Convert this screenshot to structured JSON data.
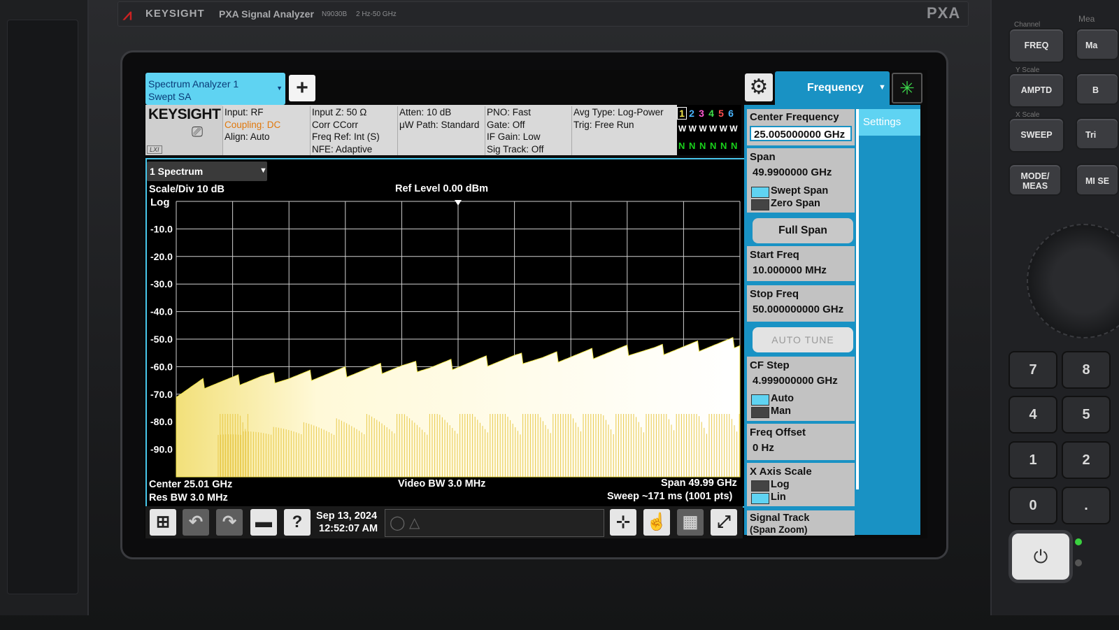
{
  "instrument": {
    "brand": "KEYSIGHT",
    "model": "PXA Signal Analyzer",
    "model_number": "N9030B",
    "freq_range": "2 Hz-50 GHz",
    "series_logo": "PXA"
  },
  "header": {
    "mode_tab_line1": "Spectrum Analyzer 1",
    "mode_tab_line2": "Swept SA",
    "add_label": "+",
    "menu_title": "Frequency"
  },
  "infobar": {
    "logo": "KEYSIGHT",
    "lxi": "LXI",
    "col1": [
      "Input: RF",
      "Coupling: DC",
      "Align: Auto"
    ],
    "col2": [
      "Input Z: 50 Ω",
      "Corr CCorr",
      "Freq Ref: Int (S)",
      "NFE: Adaptive"
    ],
    "col3": [
      "Atten: 10 dB",
      "μW Path: Standard"
    ],
    "col4": [
      "PNO: Fast",
      "Gate: Off",
      "IF Gain: Low",
      "Sig Track: Off"
    ],
    "col5": [
      "Avg Type: Log-Power",
      "Trig: Free Run"
    ],
    "traces": {
      "numbers": [
        "1",
        "2",
        "3",
        "4",
        "5",
        "6"
      ],
      "colors": [
        "#f2e64b",
        "#49b5ff",
        "#ff5ad2",
        "#3fe04a",
        "#ff4f4f",
        "#49b5ff"
      ],
      "types": "W W W W W W",
      "detectors": "N N N N N N"
    }
  },
  "graph": {
    "view": "1 Spectrum",
    "scale": "Scale/Div 10 dB",
    "log_label": "Log",
    "ref_level": "Ref Level 0.00 dBm",
    "center": "Center 25.01 GHz",
    "res_bw": "Res BW 3.0 MHz",
    "video_bw": "Video BW 3.0 MHz",
    "span": "Span 49.99 GHz",
    "sweep": "Sweep ~171 ms (1001 pts)",
    "y_ticks": [
      "-10.0",
      "-20.0",
      "-30.0",
      "-40.0",
      "-50.0",
      "-60.0",
      "-70.0",
      "-80.0",
      "-90.0"
    ],
    "trace_color": "#f2e64b"
  },
  "chart_data": {
    "type": "area",
    "title": "Ref Level 0.00 dBm",
    "xlabel": "",
    "ylabel": "",
    "xlim": [
      0.01,
      50.0
    ],
    "ylim": [
      -100,
      0
    ],
    "grid": true,
    "series": [
      {
        "x": [
          0.01,
          2.5,
          5,
          7.5,
          10,
          12.5,
          15,
          17.5,
          20,
          22.5,
          25,
          27.5,
          30,
          32.5,
          35,
          37.5,
          40,
          42.5,
          45,
          47.5,
          50
        ],
        "values": [
          -70,
          -66,
          -65,
          -64,
          -64,
          -63,
          -62,
          -61,
          -60,
          -60,
          -59,
          -58,
          -57,
          -57,
          -56,
          -55,
          -54,
          -54,
          -53,
          -52,
          -51
        ]
      }
    ]
  },
  "panel": {
    "tab": "Settings",
    "center_freq_label": "Center Frequency",
    "center_freq_value": "25.005000000 GHz",
    "span_label": "Span",
    "span_value": "49.9900000 GHz",
    "swept_span": "Swept Span",
    "zero_span": "Zero Span",
    "full_span": "Full Span",
    "start_label": "Start Freq",
    "start_value": "10.000000 MHz",
    "stop_label": "Stop Freq",
    "stop_value": "50.000000000 GHz",
    "auto_tune": "AUTO TUNE",
    "cf_step_label": "CF Step",
    "cf_step_value": "4.999000000 GHz",
    "auto": "Auto",
    "man": "Man",
    "offset_label": "Freq Offset",
    "offset_value": "0 Hz",
    "xaxis_label": "X Axis Scale",
    "log": "Log",
    "lin": "Lin",
    "signal_track_l1": "Signal Track",
    "signal_track_l2": "(Span Zoom)"
  },
  "taskbar": {
    "date": "Sep 13, 2024",
    "time": "12:52:07 AM",
    "icons": [
      "windows-icon",
      "undo-icon",
      "redo-icon",
      "folder-icon",
      "help-icon"
    ]
  },
  "hardware": {
    "channel_label": "Channel",
    "freq": "FREQ",
    "yscale_label": "Y Scale",
    "amptd": "AMPTD",
    "xscale_label": "X Scale",
    "sweep": "SWEEP",
    "mode_meas_l1": "MODE/",
    "mode_meas_l2": "MEAS",
    "right_col": [
      "Ma",
      "B",
      "Tri",
      "MI SE"
    ],
    "meas_label": "Mea",
    "keys": [
      "7",
      "8",
      "4",
      "5",
      "1",
      "2",
      "0",
      "."
    ]
  }
}
